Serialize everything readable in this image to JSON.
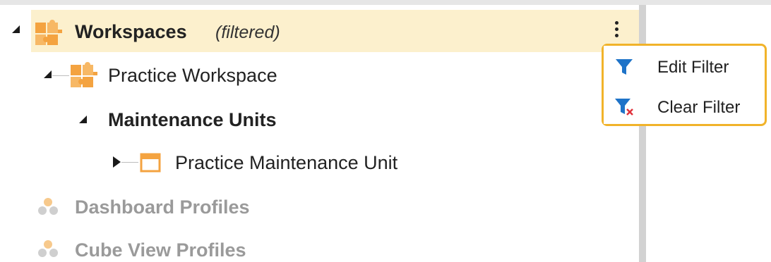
{
  "tree": {
    "workspaces": {
      "label": "Workspaces",
      "filter_note": "(filtered)",
      "icon": "puzzle-icon"
    },
    "practice_workspace": {
      "label": "Practice Workspace",
      "icon": "puzzle-icon"
    },
    "maintenance_units": {
      "label": "Maintenance Units"
    },
    "practice_unit": {
      "label": "Practice Maintenance Unit",
      "icon": "calendar-box-icon"
    },
    "dashboard_profiles": {
      "label": "Dashboard Profiles",
      "icon": "cluster-icon"
    },
    "cube_view_profiles": {
      "label": "Cube View Profiles",
      "icon": "cluster-icon"
    }
  },
  "context_menu": {
    "items": [
      {
        "label": "Edit Filter",
        "icon": "filter-icon"
      },
      {
        "label": "Clear Filter",
        "icon": "filter-clear-icon"
      }
    ]
  },
  "colors": {
    "selection_bg": "#fcf0cd",
    "menu_border": "#f1b32a",
    "accent_orange": "#f4a340",
    "filter_blue": "#1e73c8",
    "clear_red": "#e0323c",
    "muted_text": "#9a9a9a"
  }
}
